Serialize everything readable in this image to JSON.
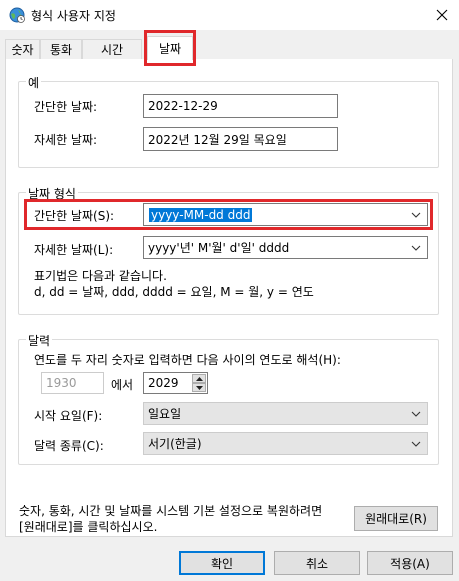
{
  "window": {
    "title": "형식 사용자 지정",
    "app_icon": "globe-clock-icon",
    "close_icon": "close-icon"
  },
  "tabs": [
    {
      "label": "숫자",
      "active": false
    },
    {
      "label": "통화",
      "active": false
    },
    {
      "label": "시간",
      "active": false
    },
    {
      "label": "날짜",
      "active": true
    }
  ],
  "example": {
    "legend": "예",
    "short_label": "간단한 날짜:",
    "short_value": "2022-12-29",
    "long_label": "자세한 날짜:",
    "long_value": "2022년 12월 29일 목요일"
  },
  "date_format": {
    "legend": "날짜 형식",
    "short_label": "간단한 날짜(S):",
    "short_value": "yyyy-MM-dd ddd",
    "long_label": "자세한 날짜(L):",
    "long_value": "yyyy'년' M'월' d'일' dddd",
    "notation_line1": "표기법은 다음과 같습니다.",
    "notation_line2": "d, dd = 날짜,  ddd, dddd = 요일,  M = 월,  y = 연도"
  },
  "calendar": {
    "legend": "달력",
    "two_digit_text": "연도를 두 자리 숫자로 입력하면 다음 사이의 연도로 해석(H):",
    "year_from": "1930",
    "between_text": "에서",
    "year_to": "2029",
    "first_day_label": "시작 요일(F):",
    "first_day_value": "일요일",
    "calendar_type_label": "달력 종류(C):",
    "calendar_type_value": "서기(한글)"
  },
  "reset": {
    "text_line1": "숫자, 통화, 시간 및 날짜를 시스템 기본 설정으로 복원하려면",
    "text_line2": "[원래대로]를 클릭하십시오.",
    "button": "원래대로(R)"
  },
  "footer": {
    "ok": "확인",
    "cancel": "취소",
    "apply": "적용(A)"
  },
  "colors": {
    "highlight": "#0078d7",
    "annotation_red": "#e0282b"
  }
}
